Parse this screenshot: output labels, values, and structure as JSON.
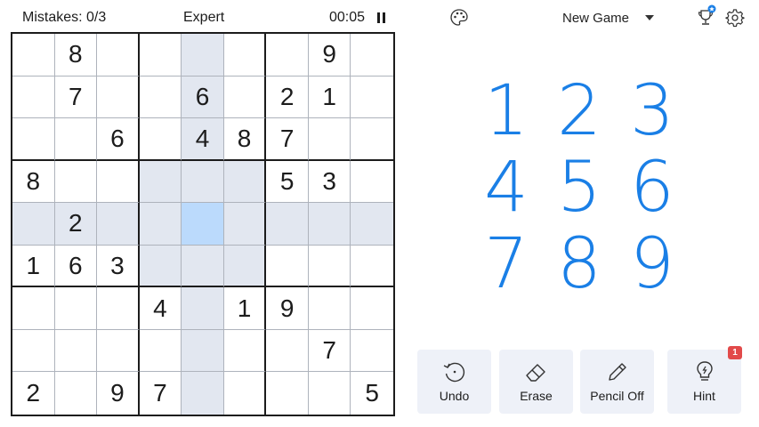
{
  "status": {
    "mistakes": "Mistakes: 0/3",
    "difficulty": "Expert",
    "timer": "00:05",
    "pause_icon": "pause-icon"
  },
  "header": {
    "palette_icon": "palette-icon",
    "new_game": "New Game",
    "trophy_icon": "trophy-icon",
    "settings_icon": "gear-icon"
  },
  "board": {
    "rows": [
      [
        "",
        "8",
        "",
        "",
        "",
        "",
        "",
        "9",
        ""
      ],
      [
        "",
        "7",
        "",
        "",
        "6",
        "",
        "2",
        "1",
        ""
      ],
      [
        "",
        "",
        "6",
        "",
        "4",
        "8",
        "7",
        "",
        ""
      ],
      [
        "8",
        "",
        "",
        "",
        "",
        "",
        "5",
        "3",
        ""
      ],
      [
        "",
        "2",
        "",
        "",
        "",
        "",
        "",
        "",
        ""
      ],
      [
        "1",
        "6",
        "3",
        "",
        "",
        "",
        "",
        "",
        ""
      ],
      [
        "",
        "",
        "",
        "4",
        "",
        "1",
        "9",
        "",
        ""
      ],
      [
        "",
        "",
        "",
        "",
        "",
        "",
        "",
        "7",
        ""
      ],
      [
        "2",
        "",
        "9",
        "7",
        "",
        "",
        "",
        "",
        "5"
      ]
    ],
    "selected_row": 5,
    "selected_col": 5
  },
  "numpad": [
    "1",
    "2",
    "3",
    "4",
    "5",
    "6",
    "7",
    "8",
    "9"
  ],
  "tools": {
    "undo": "Undo",
    "erase": "Erase",
    "pencil": "Pencil Off",
    "hint": "Hint",
    "hint_count": "1"
  },
  "colors": {
    "accent": "#1a7fe6",
    "highlight": "#e2e7f0",
    "selected": "#bbdafc",
    "badge": "#e24a4a"
  }
}
